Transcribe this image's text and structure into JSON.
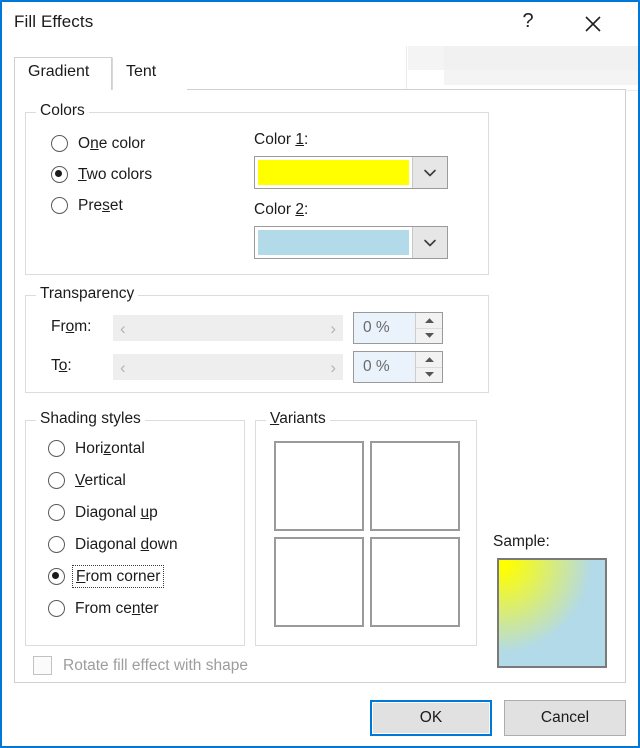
{
  "window": {
    "title": "Fill Effects",
    "help_glyph": "?",
    "close_glyph": "✕"
  },
  "tabs": [
    {
      "label": "Gradient",
      "active": true
    },
    {
      "label": "Tent",
      "active": false
    }
  ],
  "colors_group": {
    "legend": "Colors",
    "options": [
      {
        "label_pre": "O",
        "label_mn": "n",
        "label_post": "e color",
        "checked": false
      },
      {
        "label_pre": "",
        "label_mn": "T",
        "label_post": "wo colors",
        "checked": true
      },
      {
        "label_pre": "Pre",
        "label_mn": "s",
        "label_post": "et",
        "checked": false
      }
    ],
    "color1": {
      "label_pre": "Color ",
      "label_mn": "1",
      "label_post": ":",
      "value": "#FFFF00"
    },
    "color2": {
      "label_pre": "Color ",
      "label_mn": "2",
      "label_post": ":",
      "value": "#B3DAE8"
    },
    "dropdown_glyph": "⌄"
  },
  "transparency_group": {
    "legend": "Transparency",
    "rows": [
      {
        "label_pre": "Fr",
        "label_mn": "o",
        "label_post": "m:",
        "value": "0 %",
        "left_glyph": "‹",
        "right_glyph": "›"
      },
      {
        "label_pre": "T",
        "label_mn": "o",
        "label_post": ":",
        "value": "0 %",
        "left_glyph": "‹",
        "right_glyph": "›"
      }
    ]
  },
  "shading_group": {
    "legend": "Shading styles",
    "options": [
      {
        "label_pre": "Hori",
        "label_mn": "z",
        "label_post": "ontal",
        "checked": false,
        "focused": false
      },
      {
        "label_pre": "",
        "label_mn": "V",
        "label_post": "ertical",
        "checked": false,
        "focused": false
      },
      {
        "label_pre": "Diagonal ",
        "label_mn": "u",
        "label_post": "p",
        "checked": false,
        "focused": false
      },
      {
        "label_pre": "Diagonal ",
        "label_mn": "d",
        "label_post": "own",
        "checked": false,
        "focused": false
      },
      {
        "label_pre": "",
        "label_mn": "F",
        "label_post": "rom corner",
        "checked": true,
        "focused": true
      },
      {
        "label_pre": "From ce",
        "label_mn": "n",
        "label_post": "ter",
        "checked": false,
        "focused": false
      }
    ]
  },
  "variants_group": {
    "legend_pre": "",
    "legend_mn": "V",
    "legend_post": "ariants",
    "items": [
      {
        "name": "variant-top-left",
        "corner": "top-left",
        "selected": false
      },
      {
        "name": "variant-top-right",
        "corner": "top-right",
        "selected": false
      },
      {
        "name": "variant-bottom-left",
        "corner": "bottom-left",
        "selected": false
      },
      {
        "name": "variant-bottom-right",
        "corner": "bottom-right",
        "selected": false
      }
    ]
  },
  "sample": {
    "label": "Sample:",
    "corner": "top-left"
  },
  "rotate": {
    "label": "Rotate fill effect with shape",
    "checked": false,
    "enabled": false
  },
  "buttons": {
    "ok": "OK",
    "cancel": "Cancel"
  },
  "palette": {
    "accent": "#0078d7",
    "color1": "#FFFF00",
    "color2": "#B3DAE8",
    "dialog_bg": "#FFFFFF",
    "group_border": "#DCDCDC"
  }
}
